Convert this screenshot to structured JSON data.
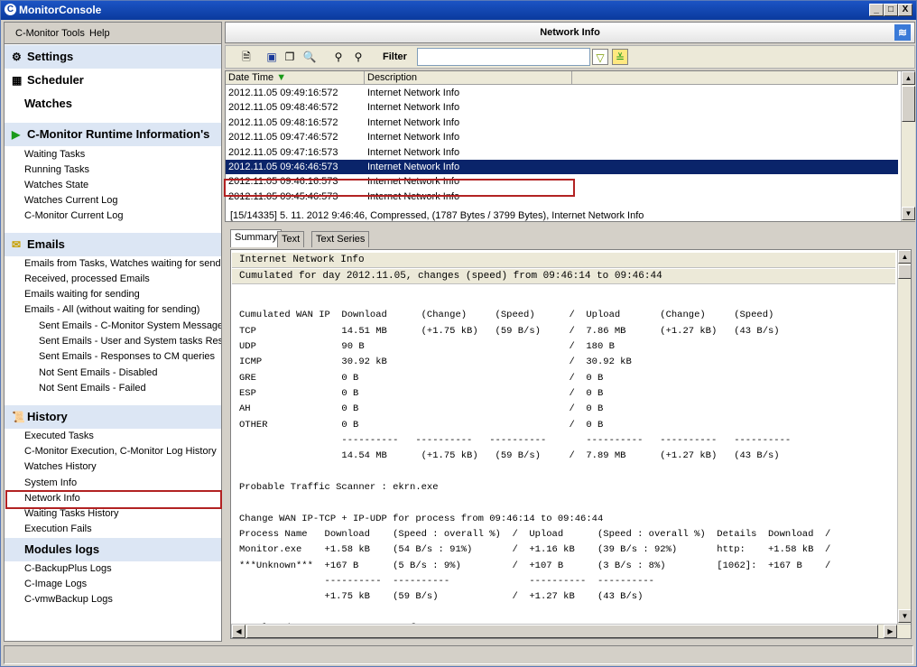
{
  "window": {
    "title": "MonitorConsole",
    "app_icon": "C",
    "controls": [
      "_",
      "□",
      "X"
    ]
  },
  "menu": {
    "items": [
      "C-Monitor Tools",
      "Help"
    ]
  },
  "sidebar": {
    "settings": "Settings",
    "scheduler": "Scheduler",
    "watches": "Watches",
    "runtime": "C-Monitor Runtime Information's",
    "runtime_items": [
      "Waiting Tasks",
      "Running Tasks",
      "Watches State",
      "Watches Current Log",
      "C-Monitor Current Log"
    ],
    "emails": "Emails",
    "email_items": [
      "Emails from Tasks, Watches waiting for sending",
      "Received, processed Emails",
      "Emails waiting for sending",
      "Emails - All (without waiting for sending)"
    ],
    "email_sub_items": [
      "Sent Emails - C-Monitor System Messages",
      "Sent Emails - User and System tasks Results",
      "Sent Emails - Responses to CM queries",
      "Not Sent Emails - Disabled",
      "Not Sent Emails - Failed"
    ],
    "history": "History",
    "history_items": [
      "Executed Tasks",
      "C-Monitor Execution, C-Monitor Log History",
      "Watches History",
      "System Info",
      "Network Info",
      "Waiting Tasks History",
      "Execution Fails"
    ],
    "modules": "Modules logs",
    "module_items": [
      "C-BackupPlus Logs",
      "C-Image Logs",
      "C-vmwBackup Logs"
    ],
    "selected": "Network Info"
  },
  "panel": {
    "title": "Network Info"
  },
  "toolbar": {
    "filter_label": "Filter",
    "filter_value": ""
  },
  "grid": {
    "columns": [
      "Date Time",
      "Description"
    ],
    "rows": [
      [
        "2012.11.05  09:49:16:572",
        "Internet Network Info"
      ],
      [
        "2012.11.05  09:48:46:572",
        "Internet Network Info"
      ],
      [
        "2012.11.05  09:48:16:572",
        "Internet Network Info"
      ],
      [
        "2012.11.05  09:47:46:572",
        "Internet Network Info"
      ],
      [
        "2012.11.05  09:47:16:573",
        "Internet Network Info"
      ],
      [
        "2012.11.05  09:46:46:573",
        "Internet Network Info"
      ],
      [
        "2012.11.05  09:46:16:573",
        "Internet Network Info"
      ],
      [
        "2012.11.05  09:45:46:573",
        "Internet Network Info"
      ]
    ],
    "selected_index": 5
  },
  "info": "[15/14335]  5. 11. 2012 9:46:46, Compressed, (1787 Bytes / 3799 Bytes), Internet Network Info",
  "tabs": [
    "Summary",
    "Text",
    "Text Series"
  ],
  "summary": {
    "header1": "Internet Network Info",
    "header2": "Cumulated for day 2012.11.05, changes (speed) from 09:46:14 to 09:46:44",
    "lines": [
      "",
      "Cumulated WAN IP  Download      (Change)     (Speed)      /  Upload       (Change)     (Speed)",
      "TCP               14.51 MB      (+1.75 kB)   (59 B/s)     /  7.86 MB      (+1.27 kB)   (43 B/s)",
      "UDP               90 B                                    /  180 B",
      "ICMP              30.92 kB                                /  30.92 kB",
      "GRE               0 B                                     /  0 B",
      "ESP               0 B                                     /  0 B",
      "AH                0 B                                     /  0 B",
      "OTHER             0 B                                     /  0 B",
      "                  ----------   ----------   ----------       ----------   ----------   ----------",
      "                  14.54 MB      (+1.75 kB)   (59 B/s)     /  7.89 MB      (+1.27 kB)   (43 B/s)",
      "",
      "Probable Traffic Scanner : ekrn.exe",
      "",
      "Change WAN IP-TCP + IP-UDP for process from 09:46:14 to 09:46:44",
      "Process Name   Download    (Speed : overall %)  /  Upload      (Speed : overall %)  Details  Download  /",
      "Monitor.exe    +1.58 kB    (54 B/s : 91%)       /  +1.16 kB    (39 B/s : 92%)       http:    +1.58 kB  /",
      "***Unknown***  +167 B      (5 B/s : 9%)         /  +107 B      (3 B/s : 8%)         [1062]:  +167 B    /",
      "               ----------  ----------              ----------  ----------",
      "               +1.75 kB    (59 B/s)             /  +1.27 kB    (43 B/s)",
      "",
      "Cumulated WAN IP-TCP + IP-UDP for process"
    ]
  }
}
